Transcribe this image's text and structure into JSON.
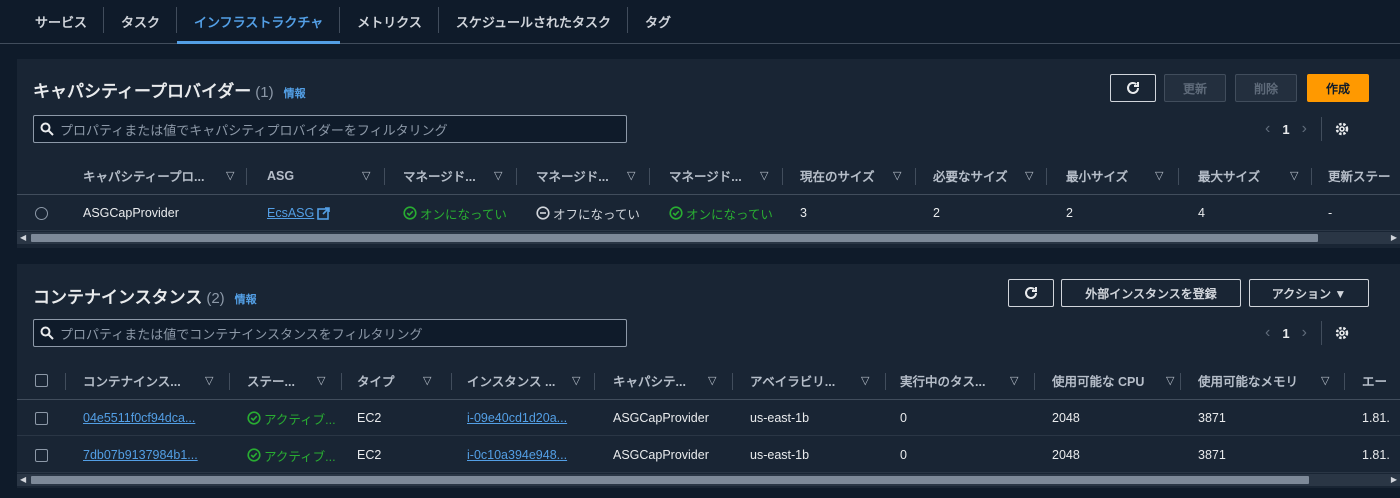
{
  "tabs": [
    {
      "label": "サービス"
    },
    {
      "label": "タスク"
    },
    {
      "label": "インフラストラクチャ"
    },
    {
      "label": "メトリクス"
    },
    {
      "label": "スケジュールされたタスク"
    },
    {
      "label": "タグ"
    }
  ],
  "active_tab": "インフラストラクチャ",
  "colors": {
    "accent": "#539fe5",
    "primary_button": "#ff9900",
    "status_green": "#29ad32"
  },
  "capacity": {
    "title": "キャパシティープロバイダー",
    "count": "(1)",
    "info": "情報",
    "buttons": {
      "refresh_icon": "refresh-icon",
      "update": "更新",
      "delete": "削除",
      "create": "作成"
    },
    "search_placeholder": "プロパティまたは値でキャパシティプロバイダーをフィルタリング",
    "page": "1",
    "columns": [
      "キャパシティープロ...",
      "ASG",
      "マネージド...",
      "マネージド...",
      "マネージド...",
      "現在のサイズ",
      "必要なサイズ",
      "最小サイズ",
      "最大サイズ",
      "更新ステー"
    ],
    "rows": [
      {
        "name": "ASGCapProvider",
        "asg": "EcsASG",
        "m1": "オンになってい",
        "m2": "オフになってい",
        "m3": "オンになってい",
        "current": "3",
        "desired": "2",
        "min": "2",
        "max": "4",
        "status": "-"
      }
    ]
  },
  "container": {
    "title": "コンテナインスタンス",
    "count": "(2)",
    "info": "情報",
    "buttons": {
      "register": "外部インスタンスを登録",
      "actions": "アクション ▼"
    },
    "search_placeholder": "プロパティまたは値でコンテナインスタンスをフィルタリング",
    "page": "1",
    "columns": [
      "コンテナインス...",
      "ステー...",
      "タイプ",
      "インスタンス ...",
      "キャパシテ...",
      "アベイラビリ...",
      "実行中のタス...",
      "使用可能な CPU",
      "使用可能なメモリ",
      "エー"
    ],
    "rows": [
      {
        "id": "04e5511f0cf94dca...",
        "status": "アクティブ...",
        "type": "EC2",
        "instance": "i-09e40cd1d20a...",
        "cap": "ASGCapProvider",
        "az": "us-east-1b",
        "tasks": "0",
        "cpu": "2048",
        "mem": "3871",
        "agent": "1.81."
      },
      {
        "id": "7db07b9137984b1...",
        "status": "アクティブ...",
        "type": "EC2",
        "instance": "i-0c10a394e948...",
        "cap": "ASGCapProvider",
        "az": "us-east-1b",
        "tasks": "0",
        "cpu": "2048",
        "mem": "3871",
        "agent": "1.81."
      }
    ]
  }
}
